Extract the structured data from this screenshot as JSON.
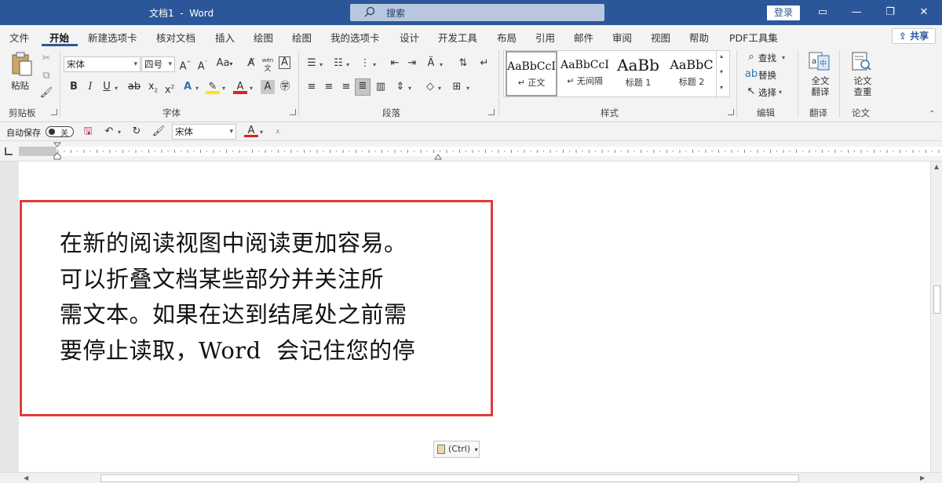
{
  "window": {
    "title": "文档1  -  Word",
    "search_placeholder": "搜索",
    "login_label": "登录"
  },
  "tabs": [
    "文件",
    "开始",
    "新建选项卡",
    "核对文档",
    "插入",
    "绘图",
    "绘图",
    "我的选项卡",
    "设计",
    "开发工具",
    "布局",
    "引用",
    "邮件",
    "审阅",
    "视图",
    "帮助",
    "PDF工具集"
  ],
  "active_tab": "开始",
  "share_label": "共享",
  "ribbon": {
    "clipboard": {
      "label": "剪贴板",
      "paste": "粘贴"
    },
    "font": {
      "label": "字体",
      "font_name": "宋体",
      "font_size": "四号",
      "wen_icon": "wén",
      "wen_icon_sub": "文"
    },
    "paragraph": {
      "label": "段落"
    },
    "styles": {
      "label": "样式",
      "items": [
        {
          "preview": "AaBbCcI",
          "name": "↵ 正文"
        },
        {
          "preview": "AaBbCcI",
          "name": "↵ 无间隔"
        },
        {
          "preview": "AaBb",
          "name": "标题 1"
        },
        {
          "preview": "AaBbC",
          "name": "标题 2"
        }
      ]
    },
    "editing": {
      "label": "编辑",
      "find": "查找",
      "replace": "替换",
      "select": "选择"
    },
    "translate": {
      "label": "翻译",
      "button_line1": "全文",
      "button_line2": "翻译"
    },
    "paper": {
      "label": "论文",
      "button_line1": "论文",
      "button_line2": "查重"
    }
  },
  "qat": {
    "autosave_label": "自动保存",
    "autosave_state": "关",
    "font_name": "宋体"
  },
  "document": {
    "lines": [
      "在新的阅读视图中阅读更加容易。",
      "可以折叠文档某些部分并关注所",
      "需文本。如果在达到结尾处之前需",
      "要停止读取，Word  会记住您的停"
    ],
    "paste_option": "(Ctrl)"
  },
  "colors": {
    "accent": "#2b579a",
    "highlight_box": "#e23a3a"
  }
}
